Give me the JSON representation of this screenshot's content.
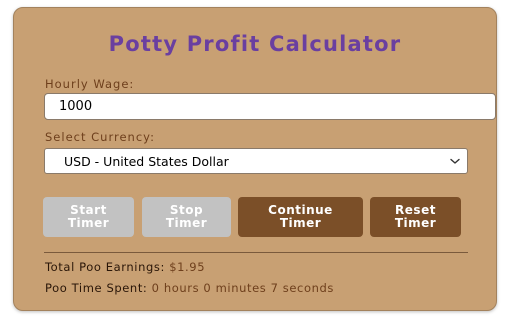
{
  "app": {
    "title": "Potty Profit Calculator"
  },
  "form": {
    "wage_label": "Hourly Wage:",
    "wage_value": "1000",
    "currency_label": "Select Currency:",
    "currency_selected": "USD - United States Dollar"
  },
  "buttons": {
    "start_line1": "Start",
    "start_line2": "Timer",
    "stop_line1": "Stop",
    "stop_line2": "Timer",
    "continue_line1": "Continue",
    "continue_line2": "Timer",
    "reset_line1": "Reset",
    "reset_line2": "Timer"
  },
  "stats": {
    "earnings_label": "Total Poo Earnings:",
    "earnings_value": "$1.95",
    "time_label": "Poo Time Spent:",
    "time_value": "0 hours 0 minutes 7 seconds"
  },
  "icons": {
    "select_chevron": "chevron-down-icon"
  },
  "colors": {
    "panel_bg": "#c8a073",
    "title": "#6a3fa0",
    "label": "#6e3f1c",
    "button_active": "#7b4f28",
    "button_disabled": "#c2c2c2"
  }
}
